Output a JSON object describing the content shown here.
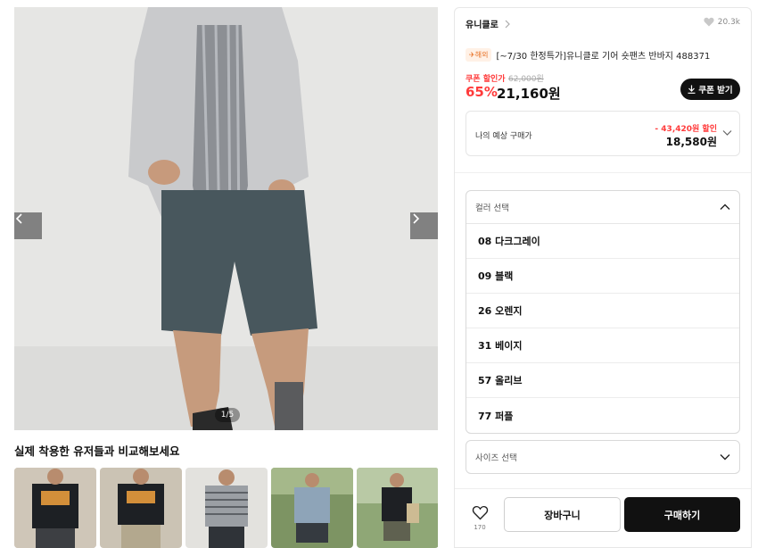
{
  "gallery": {
    "counter": "1/5",
    "reviews_title": "실제 착용한 유저들과 비교해보세요"
  },
  "product": {
    "brand": "유니클로",
    "likes": "20.3k",
    "overseas_badge": "✈해외",
    "title": "[~7/30 한정특가]유니클로 기어 숏팬츠 반바지 488371",
    "coupon_label": "쿠폰 할인가",
    "original_price": "62,000원",
    "discount_rate": "65%",
    "sale_price": "21,160원",
    "coupon_button": "쿠폰 받기"
  },
  "estimate": {
    "label": "나의 예상 구매가",
    "discount": "- 43,420원 할인",
    "price": "18,580원"
  },
  "color_select": {
    "placeholder": "컬러 선택",
    "options": [
      "08 다크그레이",
      "09 블랙",
      "26 오렌지",
      "31 베이지",
      "57 올리브",
      "77 퍼플"
    ]
  },
  "size_select": {
    "placeholder": "사이즈 선택"
  },
  "actions": {
    "like_count": "170",
    "cart": "장바구니",
    "buy": "구매하기"
  },
  "colors": {
    "accent_red": "#ff3b3b",
    "primary_dark": "#111111"
  }
}
